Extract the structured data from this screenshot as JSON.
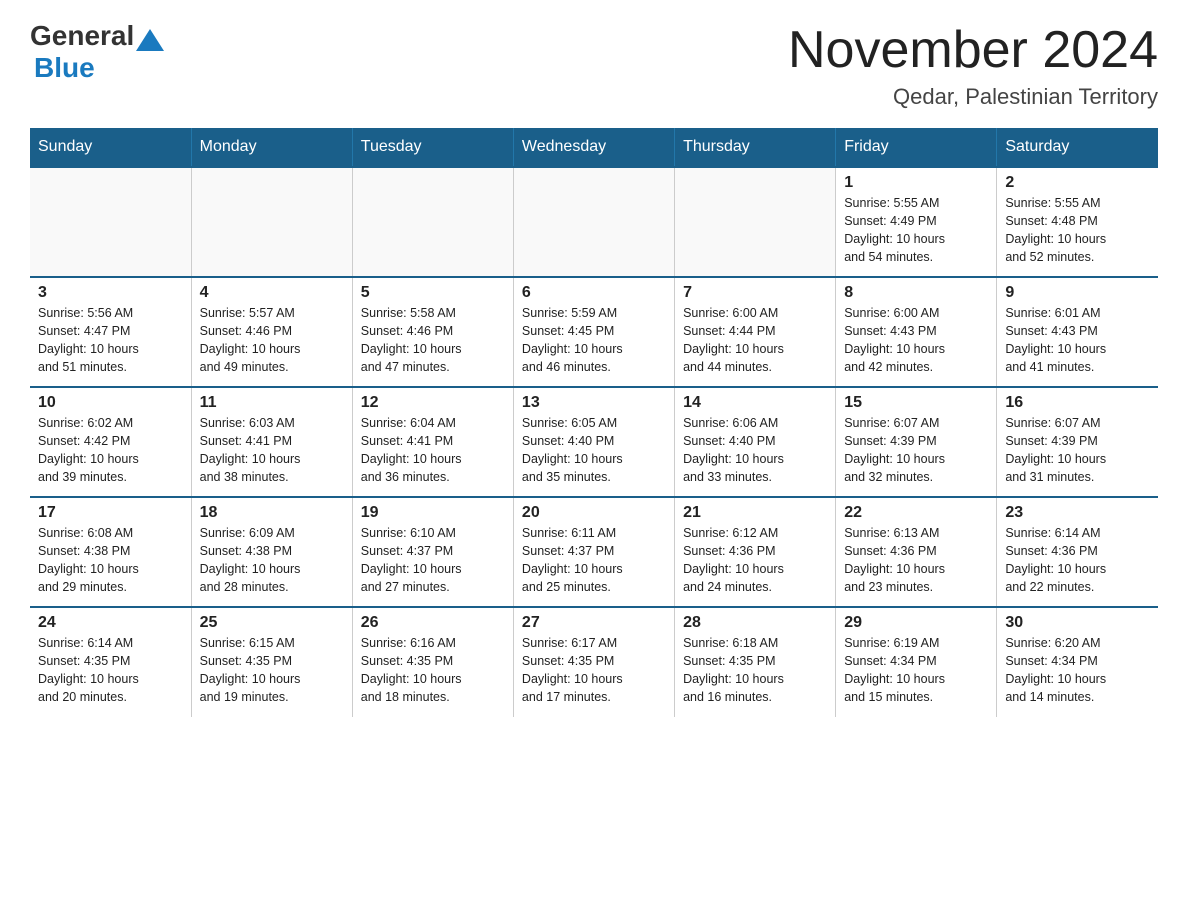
{
  "header": {
    "logo_general": "General",
    "logo_blue": "Blue",
    "title": "November 2024",
    "subtitle": "Qedar, Palestinian Territory"
  },
  "calendar": {
    "days_of_week": [
      "Sunday",
      "Monday",
      "Tuesday",
      "Wednesday",
      "Thursday",
      "Friday",
      "Saturday"
    ],
    "weeks": [
      [
        {
          "day": "",
          "info": ""
        },
        {
          "day": "",
          "info": ""
        },
        {
          "day": "",
          "info": ""
        },
        {
          "day": "",
          "info": ""
        },
        {
          "day": "",
          "info": ""
        },
        {
          "day": "1",
          "info": "Sunrise: 5:55 AM\nSunset: 4:49 PM\nDaylight: 10 hours\nand 54 minutes."
        },
        {
          "day": "2",
          "info": "Sunrise: 5:55 AM\nSunset: 4:48 PM\nDaylight: 10 hours\nand 52 minutes."
        }
      ],
      [
        {
          "day": "3",
          "info": "Sunrise: 5:56 AM\nSunset: 4:47 PM\nDaylight: 10 hours\nand 51 minutes."
        },
        {
          "day": "4",
          "info": "Sunrise: 5:57 AM\nSunset: 4:46 PM\nDaylight: 10 hours\nand 49 minutes."
        },
        {
          "day": "5",
          "info": "Sunrise: 5:58 AM\nSunset: 4:46 PM\nDaylight: 10 hours\nand 47 minutes."
        },
        {
          "day": "6",
          "info": "Sunrise: 5:59 AM\nSunset: 4:45 PM\nDaylight: 10 hours\nand 46 minutes."
        },
        {
          "day": "7",
          "info": "Sunrise: 6:00 AM\nSunset: 4:44 PM\nDaylight: 10 hours\nand 44 minutes."
        },
        {
          "day": "8",
          "info": "Sunrise: 6:00 AM\nSunset: 4:43 PM\nDaylight: 10 hours\nand 42 minutes."
        },
        {
          "day": "9",
          "info": "Sunrise: 6:01 AM\nSunset: 4:43 PM\nDaylight: 10 hours\nand 41 minutes."
        }
      ],
      [
        {
          "day": "10",
          "info": "Sunrise: 6:02 AM\nSunset: 4:42 PM\nDaylight: 10 hours\nand 39 minutes."
        },
        {
          "day": "11",
          "info": "Sunrise: 6:03 AM\nSunset: 4:41 PM\nDaylight: 10 hours\nand 38 minutes."
        },
        {
          "day": "12",
          "info": "Sunrise: 6:04 AM\nSunset: 4:41 PM\nDaylight: 10 hours\nand 36 minutes."
        },
        {
          "day": "13",
          "info": "Sunrise: 6:05 AM\nSunset: 4:40 PM\nDaylight: 10 hours\nand 35 minutes."
        },
        {
          "day": "14",
          "info": "Sunrise: 6:06 AM\nSunset: 4:40 PM\nDaylight: 10 hours\nand 33 minutes."
        },
        {
          "day": "15",
          "info": "Sunrise: 6:07 AM\nSunset: 4:39 PM\nDaylight: 10 hours\nand 32 minutes."
        },
        {
          "day": "16",
          "info": "Sunrise: 6:07 AM\nSunset: 4:39 PM\nDaylight: 10 hours\nand 31 minutes."
        }
      ],
      [
        {
          "day": "17",
          "info": "Sunrise: 6:08 AM\nSunset: 4:38 PM\nDaylight: 10 hours\nand 29 minutes."
        },
        {
          "day": "18",
          "info": "Sunrise: 6:09 AM\nSunset: 4:38 PM\nDaylight: 10 hours\nand 28 minutes."
        },
        {
          "day": "19",
          "info": "Sunrise: 6:10 AM\nSunset: 4:37 PM\nDaylight: 10 hours\nand 27 minutes."
        },
        {
          "day": "20",
          "info": "Sunrise: 6:11 AM\nSunset: 4:37 PM\nDaylight: 10 hours\nand 25 minutes."
        },
        {
          "day": "21",
          "info": "Sunrise: 6:12 AM\nSunset: 4:36 PM\nDaylight: 10 hours\nand 24 minutes."
        },
        {
          "day": "22",
          "info": "Sunrise: 6:13 AM\nSunset: 4:36 PM\nDaylight: 10 hours\nand 23 minutes."
        },
        {
          "day": "23",
          "info": "Sunrise: 6:14 AM\nSunset: 4:36 PM\nDaylight: 10 hours\nand 22 minutes."
        }
      ],
      [
        {
          "day": "24",
          "info": "Sunrise: 6:14 AM\nSunset: 4:35 PM\nDaylight: 10 hours\nand 20 minutes."
        },
        {
          "day": "25",
          "info": "Sunrise: 6:15 AM\nSunset: 4:35 PM\nDaylight: 10 hours\nand 19 minutes."
        },
        {
          "day": "26",
          "info": "Sunrise: 6:16 AM\nSunset: 4:35 PM\nDaylight: 10 hours\nand 18 minutes."
        },
        {
          "day": "27",
          "info": "Sunrise: 6:17 AM\nSunset: 4:35 PM\nDaylight: 10 hours\nand 17 minutes."
        },
        {
          "day": "28",
          "info": "Sunrise: 6:18 AM\nSunset: 4:35 PM\nDaylight: 10 hours\nand 16 minutes."
        },
        {
          "day": "29",
          "info": "Sunrise: 6:19 AM\nSunset: 4:34 PM\nDaylight: 10 hours\nand 15 minutes."
        },
        {
          "day": "30",
          "info": "Sunrise: 6:20 AM\nSunset: 4:34 PM\nDaylight: 10 hours\nand 14 minutes."
        }
      ]
    ]
  }
}
